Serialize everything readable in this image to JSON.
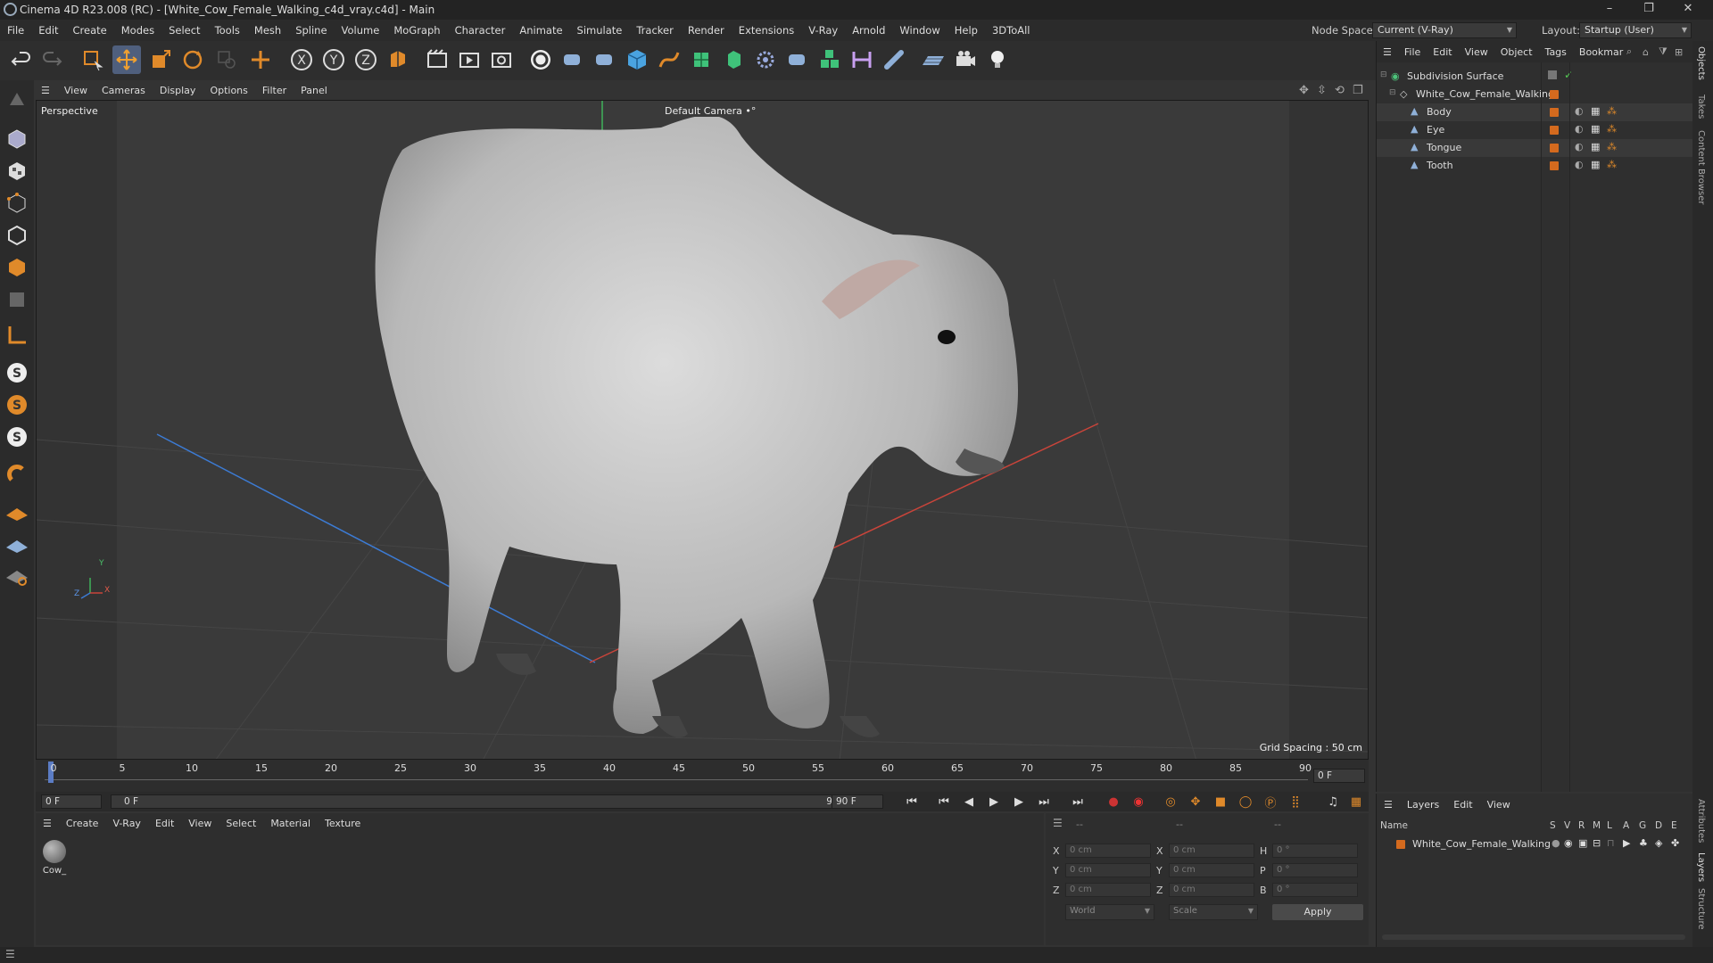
{
  "window": {
    "title": "Cinema 4D R23.008 (RC) - [White_Cow_Female_Walking_c4d_vray.c4d] - Main",
    "minimize": "–",
    "restore": "❐",
    "close": "✕"
  },
  "menubar": {
    "items": [
      "File",
      "Edit",
      "Create",
      "Modes",
      "Select",
      "Tools",
      "Mesh",
      "Spline",
      "Volume",
      "MoGraph",
      "Character",
      "Animate",
      "Simulate",
      "Tracker",
      "Render",
      "Extensions",
      "V-Ray",
      "Arnold",
      "Window",
      "Help",
      "3DToAll"
    ],
    "node_space_label": "Node Space:",
    "node_space_value": "Current (V-Ray)",
    "layout_label": "Layout:",
    "layout_value": "Startup (User)"
  },
  "toolbar": {
    "icons": [
      "undo-icon",
      "redo-icon",
      "live-selection-icon",
      "move-icon",
      "scale-icon",
      "rotate-icon",
      "last-tool-icon",
      "add-object-icon",
      "x-axis-icon",
      "y-axis-icon",
      "z-axis-icon",
      "coordinate-system-icon",
      "render-view-icon",
      "render-picture-viewer-icon",
      "render-settings-icon",
      "vray-logo-icon",
      "python-icon",
      "python-icon-2",
      "cube-icon",
      "pen-icon",
      "subdivision-icon",
      "extrude-icon",
      "cloner-icon",
      "python-icon-3",
      "mograph-icon",
      "deformer-icon",
      "spline-icon",
      "floor-icon",
      "camera-icon",
      "light-icon"
    ]
  },
  "viewport": {
    "menu": [
      "View",
      "Cameras",
      "Display",
      "Options",
      "Filter",
      "Panel"
    ],
    "label": "Perspective",
    "camera": "Default Camera",
    "camera_icon": "•°",
    "grid_spacing": "Grid Spacing : 50 cm",
    "axis_x": "X",
    "axis_y": "Y",
    "axis_z": "Z"
  },
  "timeline": {
    "ticks": [
      "0",
      "5",
      "10",
      "15",
      "20",
      "25",
      "30",
      "35",
      "40",
      "45",
      "50",
      "55",
      "60",
      "65",
      "70",
      "75",
      "80",
      "85",
      "90"
    ],
    "current_frame_field": "0 F",
    "start_field": "0 F",
    "range_start": "0 F",
    "range_end": "90 F",
    "end_field": "90 F"
  },
  "materials": {
    "menu": [
      "Create",
      "V-Ray",
      "Edit",
      "View",
      "Select",
      "Material",
      "Texture"
    ],
    "items": [
      {
        "name": "Cow_"
      }
    ]
  },
  "coordinates": {
    "header_left": "--",
    "header_mid": "--",
    "header_right": "--",
    "rows": [
      {
        "l1": "X",
        "v1": "0 cm",
        "l2": "X",
        "v2": "0 cm",
        "l3": "H",
        "v3": "0 °"
      },
      {
        "l1": "Y",
        "v1": "0 cm",
        "l2": "Y",
        "v2": "0 cm",
        "l3": "P",
        "v3": "0 °"
      },
      {
        "l1": "Z",
        "v1": "0 cm",
        "l2": "Z",
        "v2": "0 cm",
        "l3": "B",
        "v3": "0 °"
      }
    ],
    "world": "World",
    "scale": "Scale",
    "apply": "Apply"
  },
  "objects": {
    "menu": [
      "File",
      "Edit",
      "View",
      "Object",
      "Tags",
      "Bookmar"
    ],
    "tree": [
      {
        "name": "Subdivision Surface",
        "level": 0
      },
      {
        "name": "White_Cow_Female_Walking",
        "level": 1
      },
      {
        "name": "Body",
        "level": 2
      },
      {
        "name": "Eye",
        "level": 2
      },
      {
        "name": "Tongue",
        "level": 2
      },
      {
        "name": "Tooth",
        "level": 2
      }
    ]
  },
  "layers": {
    "menu": [
      "Layers",
      "Edit",
      "View"
    ],
    "columns": [
      "Name",
      "S",
      "V",
      "R",
      "M",
      "L",
      "A",
      "G",
      "D",
      "E"
    ],
    "rows": [
      {
        "name": "White_Cow_Female_Walking"
      }
    ]
  },
  "right_tabs": [
    "Objects",
    "Takes",
    "Content Browser",
    "Attributes",
    "Layers",
    "Structure"
  ]
}
